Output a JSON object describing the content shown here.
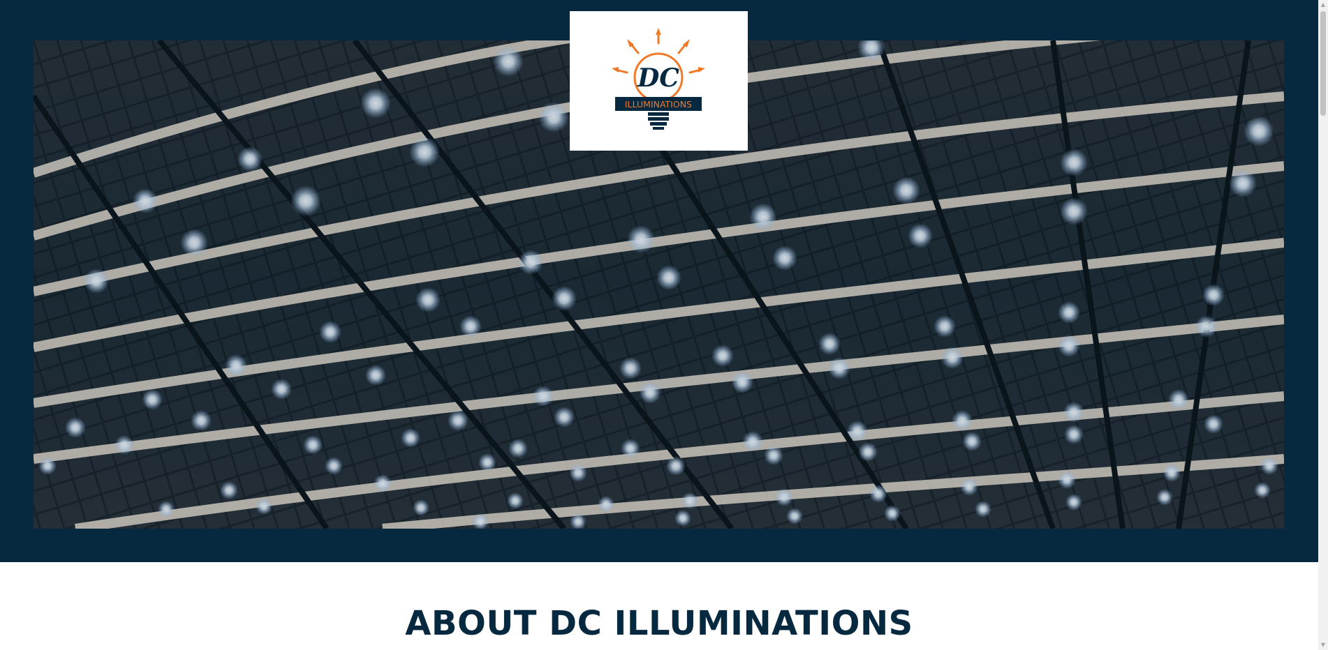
{
  "logo": {
    "monogram": "DC",
    "wordmark": "ILLUMINATIONS",
    "icon": "lightbulb-icon"
  },
  "hero": {
    "image": "warehouse-ceiling-lights-photo"
  },
  "about": {
    "heading": "ABOUT DC ILLUMINATIONS"
  },
  "scrollbar": {
    "up_icon": "▲",
    "down_icon": "▼"
  },
  "colors": {
    "brand_navy": "#072940",
    "brand_orange": "#f07a2a",
    "background": "#ffffff"
  }
}
